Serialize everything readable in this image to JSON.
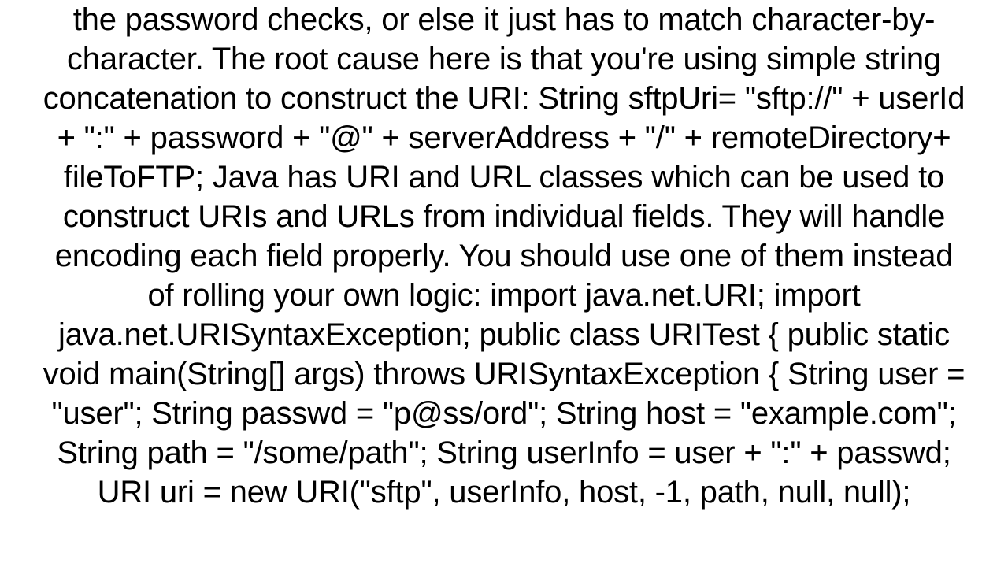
{
  "document": {
    "text": "the password checks, or else it just has to match character-by-character. The root cause here is that you're using simple string concatenation to construct the URI: String sftpUri= \"sftp://\" + userId + \":\" + password + \"@\" + serverAddress + \"/\" + remoteDirectory+ fileToFTP;  Java has URI and URL classes which can be used to construct URIs and URLs from individual fields. They will handle encoding each field properly. You should use one of them instead of rolling your own logic: import java.net.URI; import java.net.URISyntaxException;  public class URITest {     public static void main(String[] args) throws URISyntaxException {         String user = \"user\";         String passwd = \"p@ss/ord\";         String host = \"example.com\";         String path = \"/some/path\";          String userInfo = user + \":\" + passwd;         URI uri = new URI(\"sftp\", userInfo, host, -1,                 path, null, null);"
  }
}
